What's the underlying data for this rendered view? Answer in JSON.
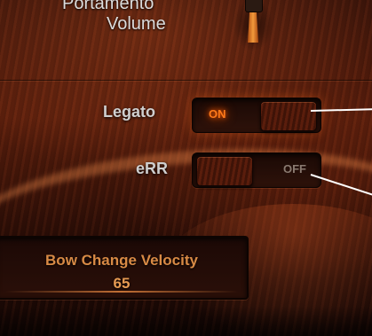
{
  "header": {
    "portamento_label": "Portamento",
    "volume_label": "Volume"
  },
  "legato": {
    "label": "Legato",
    "state_text": "ON",
    "state": "on"
  },
  "err": {
    "label": "eRR",
    "state_text": "OFF",
    "state": "off"
  },
  "bow_change_velocity": {
    "label": "Bow Change Velocity",
    "value": "65"
  },
  "colors": {
    "accent_on": "#ff7a1a",
    "label_text": "#cfcfcf",
    "value_text": "#e69a52",
    "wood_dark": "#2a0d06",
    "wood_mid": "#5a1e0c"
  },
  "icons": {
    "volume_knob": "slider-knob-icon"
  }
}
